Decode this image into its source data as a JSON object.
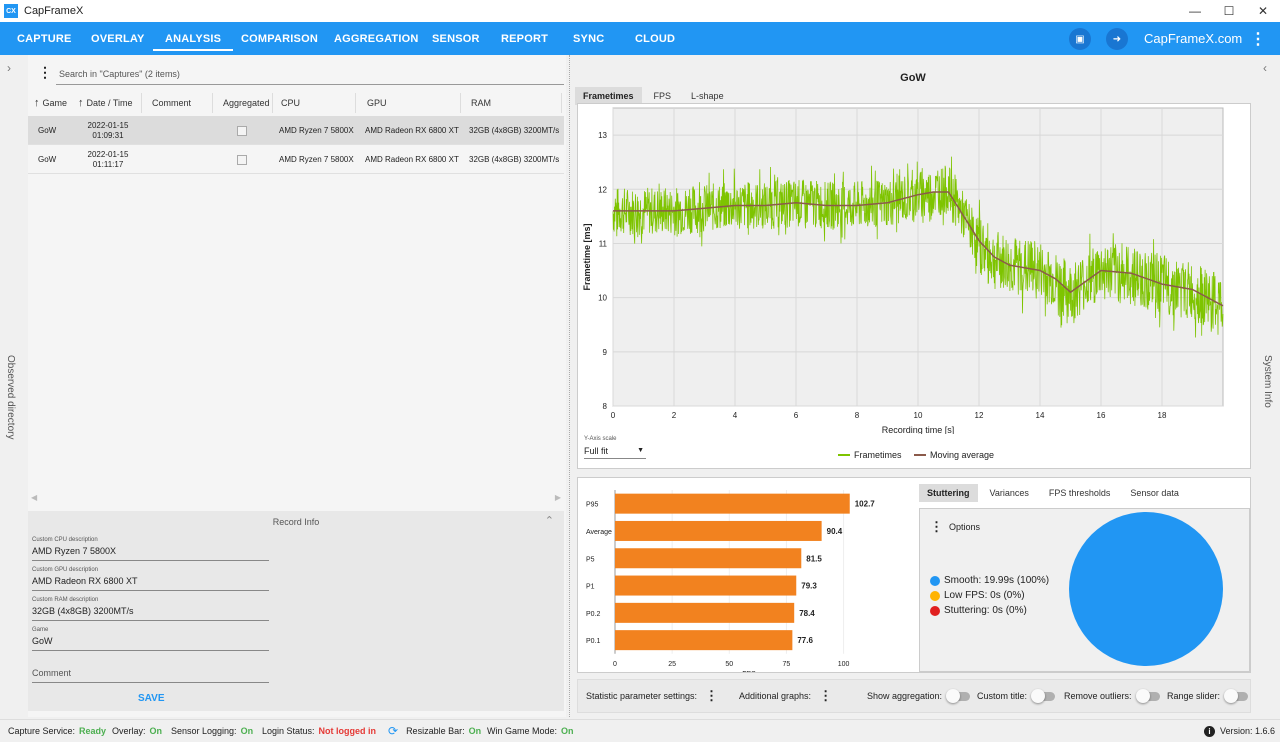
{
  "window": {
    "title": "CapFrameX",
    "icon_text": "CX"
  },
  "nav": {
    "items": [
      "CAPTURE",
      "OVERLAY",
      "ANALYSIS",
      "COMPARISON",
      "AGGREGATION",
      "SENSOR",
      "REPORT",
      "SYNC",
      "CLOUD"
    ],
    "active": "ANALYSIS",
    "site": "CapFrameX.com"
  },
  "left_sidebar_label": "Observed directory",
  "right_sidebar_label": "System Info",
  "captures": {
    "search_placeholder": "Search in \"Captures\" (2 items)",
    "columns": [
      "Game",
      "Date / Time",
      "Comment",
      "Aggregated",
      "CPU",
      "GPU",
      "RAM"
    ],
    "rows": [
      {
        "game": "GoW",
        "date": "2022-01-15",
        "time": "01:09:31",
        "comment": "",
        "cpu": "AMD Ryzen 7 5800X",
        "gpu": "AMD Radeon RX 6800 XT",
        "ram": "32GB (4x8GB) 3200MT/s"
      },
      {
        "game": "GoW",
        "date": "2022-01-15",
        "time": "01:11:17",
        "comment": "",
        "cpu": "AMD Ryzen 7 5800X",
        "gpu": "AMD Radeon RX 6800 XT",
        "ram": "32GB (4x8GB) 3200MT/s"
      }
    ]
  },
  "record_info": {
    "title": "Record Info",
    "fields": [
      {
        "label": "Custom CPU description",
        "value": "AMD Ryzen 7 5800X"
      },
      {
        "label": "Custom GPU description",
        "value": "AMD Radeon RX 6800 XT"
      },
      {
        "label": "Custom RAM description",
        "value": "32GB (4x8GB) 3200MT/s"
      },
      {
        "label": "Game",
        "value": "GoW"
      }
    ],
    "comment_placeholder": "Comment",
    "save_label": "SAVE"
  },
  "graph": {
    "title": "GoW",
    "tabs": [
      "Frametimes",
      "FPS",
      "L-shape"
    ],
    "active_tab": "Frametimes",
    "y_scale_label": "Y-Axis scale",
    "y_scale_value": "Full fit",
    "legend": [
      {
        "name": "Frametimes",
        "color": "#7ec400"
      },
      {
        "name": "Moving average",
        "color": "#8b5a4a"
      }
    ]
  },
  "stats_tabs": [
    "Stuttering",
    "Variances",
    "FPS thresholds",
    "Sensor data"
  ],
  "stats_active_tab": "Stuttering",
  "stuttering": {
    "options_label": "Options",
    "items": [
      {
        "label": "Smooth:",
        "value": "19.99s (100%)",
        "color": "#2196f3"
      },
      {
        "label": "Low FPS:",
        "value": "0s (0%)",
        "color": "#ffb300"
      },
      {
        "label": "Stuttering:",
        "value": "0s (0%)",
        "color": "#e02020"
      }
    ]
  },
  "bottom_settings": {
    "statistic_label": "Statistic parameter settings:",
    "additional_label": "Additional graphs:",
    "toggles": [
      "Show aggregation:",
      "Custom title:",
      "Remove outliers:",
      "Range slider:"
    ]
  },
  "status_bar": {
    "items": [
      {
        "label": "Capture Service:",
        "value": "Ready",
        "state": "ok"
      },
      {
        "label": "Overlay:",
        "value": "On",
        "state": "ok"
      },
      {
        "label": "Sensor Logging:",
        "value": "On",
        "state": "ok"
      },
      {
        "label": "Login Status:",
        "value": "Not logged in",
        "state": "bad"
      },
      {
        "label": "Resizable Bar:",
        "value": "On",
        "state": "ok"
      },
      {
        "label": "Win Game Mode:",
        "value": "On",
        "state": "ok"
      }
    ],
    "version_label": "Version:",
    "version_value": "1.6.6"
  },
  "chart_data": [
    {
      "type": "line",
      "title": "",
      "xlabel": "Recording time [s]",
      "ylabel": "Frametime [ms]",
      "xlim": [
        0,
        20
      ],
      "ylim": [
        8,
        13.5
      ],
      "xticks": [
        0,
        2,
        4,
        6,
        8,
        10,
        12,
        14,
        16,
        18
      ],
      "yticks": [
        8,
        9,
        10,
        11,
        12,
        13
      ],
      "grid": true,
      "legend": "bottom",
      "series": [
        {
          "name": "Frametimes",
          "color": "#7ec400",
          "x": [
            0,
            1,
            2,
            3,
            4,
            5,
            6,
            7,
            8,
            9,
            10,
            10.5,
            11,
            11.5,
            12,
            12.5,
            13,
            14,
            15,
            16,
            17,
            18,
            19,
            20
          ],
          "y": [
            11.6,
            11.6,
            11.6,
            11.65,
            11.7,
            11.7,
            11.75,
            11.7,
            11.7,
            11.75,
            11.9,
            11.95,
            12.0,
            11.5,
            11.0,
            10.7,
            10.6,
            10.5,
            10.1,
            10.5,
            10.4,
            10.25,
            10.1,
            9.85
          ],
          "min": 8.7,
          "max": 13.0
        },
        {
          "name": "Moving average",
          "color": "#8b5a4a",
          "x": [
            0,
            1,
            2,
            3,
            4,
            5,
            6,
            7,
            8,
            9,
            10,
            10.5,
            11,
            11.5,
            12,
            12.5,
            13,
            14,
            14.5,
            15,
            15.5,
            16,
            17,
            18,
            19,
            20
          ],
          "y": [
            11.6,
            11.6,
            11.6,
            11.65,
            11.7,
            11.7,
            11.75,
            11.7,
            11.7,
            11.75,
            11.9,
            11.95,
            11.95,
            11.5,
            11.05,
            10.75,
            10.6,
            10.5,
            10.35,
            10.1,
            10.3,
            10.5,
            10.45,
            10.25,
            10.15,
            9.85
          ]
        }
      ]
    },
    {
      "type": "bar",
      "orientation": "horizontal",
      "title": "",
      "xlabel": "FPS",
      "xlim": [
        0,
        105
      ],
      "xticks": [
        0,
        25,
        50,
        75,
        100
      ],
      "categories": [
        "P95",
        "Average",
        "P5",
        "P1",
        "P0.2",
        "P0.1"
      ],
      "values": [
        102.7,
        90.4,
        81.5,
        79.3,
        78.4,
        77.6
      ],
      "color": "#f2821f"
    },
    {
      "type": "pie",
      "categories": [
        "Smooth",
        "Low FPS",
        "Stuttering"
      ],
      "values": [
        100,
        0,
        0
      ],
      "colors": [
        "#2196f3",
        "#ffb300",
        "#e02020"
      ]
    }
  ]
}
